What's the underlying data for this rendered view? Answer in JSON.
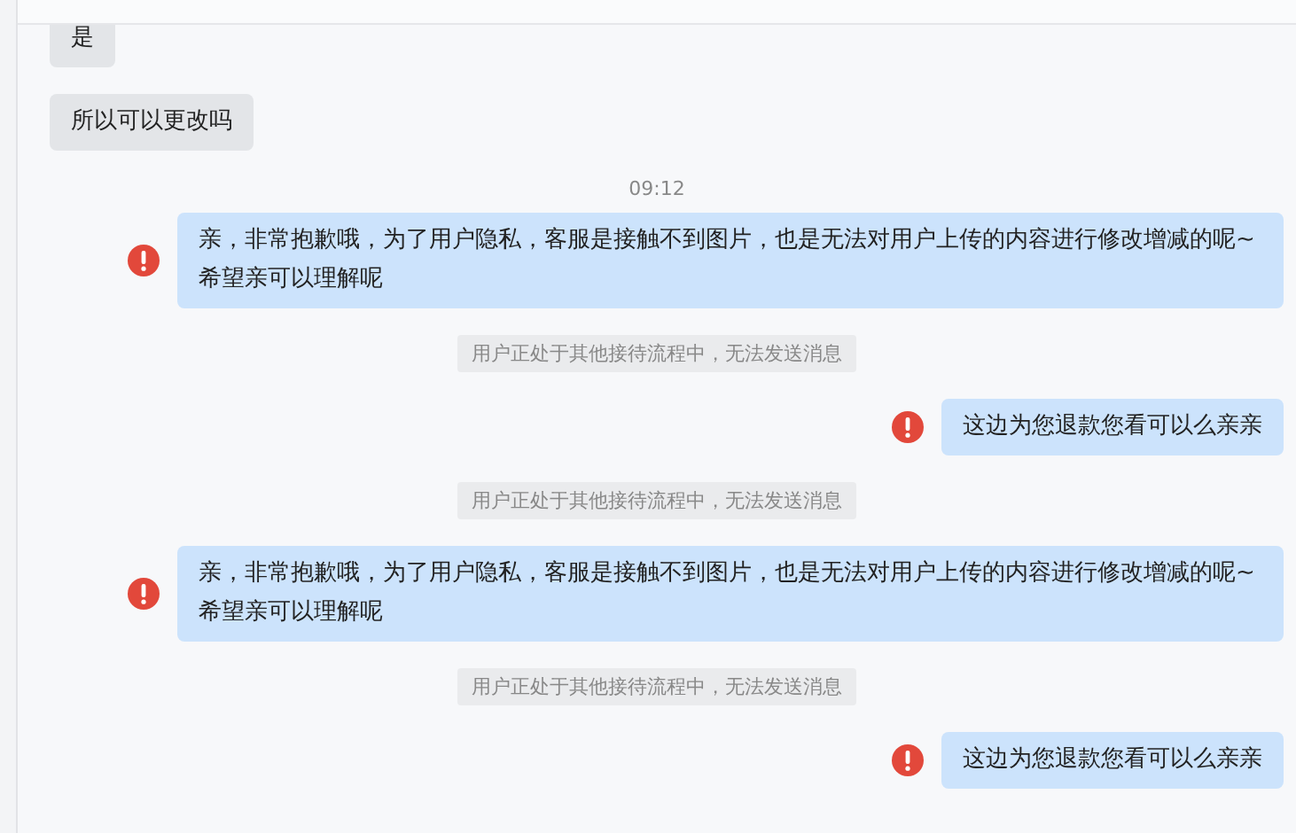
{
  "messages": [
    {
      "kind": "incoming",
      "text": "是"
    },
    {
      "kind": "incoming",
      "text": "所以可以更改吗"
    },
    {
      "kind": "time",
      "text": "09:12"
    },
    {
      "kind": "outgoing",
      "failed": true,
      "text": "亲，非常抱歉哦，为了用户隐私，客服是接触不到图片，也是无法对用户上传的内容进行修改增减的呢~希望亲可以理解呢"
    },
    {
      "kind": "system",
      "text": "用户正处于其他接待流程中，无法发送消息"
    },
    {
      "kind": "outgoing",
      "failed": true,
      "text": "这边为您退款您看可以么亲亲"
    },
    {
      "kind": "system",
      "text": "用户正处于其他接待流程中，无法发送消息"
    },
    {
      "kind": "outgoing",
      "failed": true,
      "text": "亲，非常抱歉哦，为了用户隐私，客服是接触不到图片，也是无法对用户上传的内容进行修改增减的呢~希望亲可以理解呢"
    },
    {
      "kind": "system",
      "text": "用户正处于其他接待流程中，无法发送消息"
    },
    {
      "kind": "outgoing",
      "failed": true,
      "text": "这边为您退款您看可以么亲亲"
    }
  ]
}
